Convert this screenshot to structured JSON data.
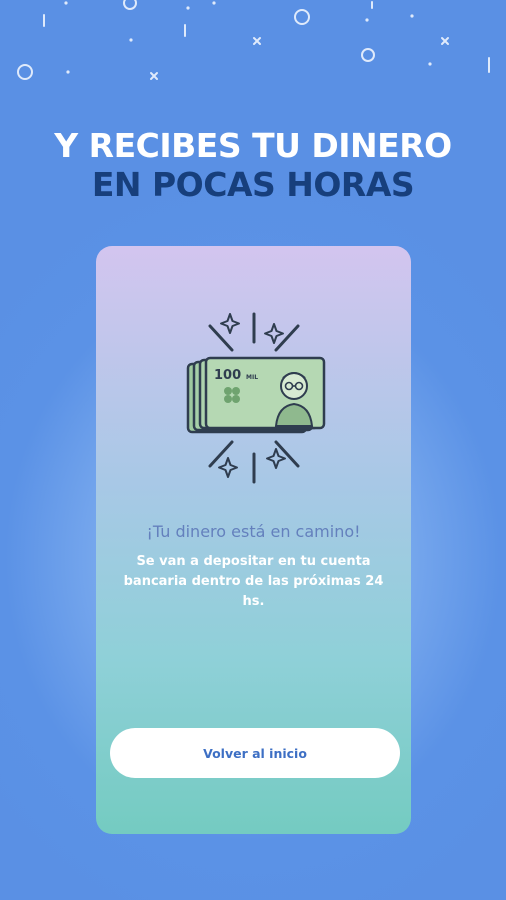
{
  "headline": {
    "line1": "Y RECIBES TU DINERO",
    "line2": "EN POCAS HORAS"
  },
  "card": {
    "title": "¡Tu dinero está en camino!",
    "body": "Se van a depositar en tu cuenta bancaria dentro de las próximas 24 hs.",
    "illustration": {
      "banknote_label": "100",
      "banknote_sublabel": "MIL",
      "icons": [
        "sparkle-icon",
        "banknote-icon",
        "portrait-icon",
        "clover-icon"
      ]
    },
    "button_label": "Volver al inicio"
  },
  "colors": {
    "background": "#5a90e4",
    "headline_primary": "#ffffff",
    "headline_secondary": "#173f7c",
    "card_top": "#d3c5ef",
    "card_bottom": "#74cbc1",
    "card_title": "#6480bd",
    "button_text": "#3d6fc4"
  }
}
